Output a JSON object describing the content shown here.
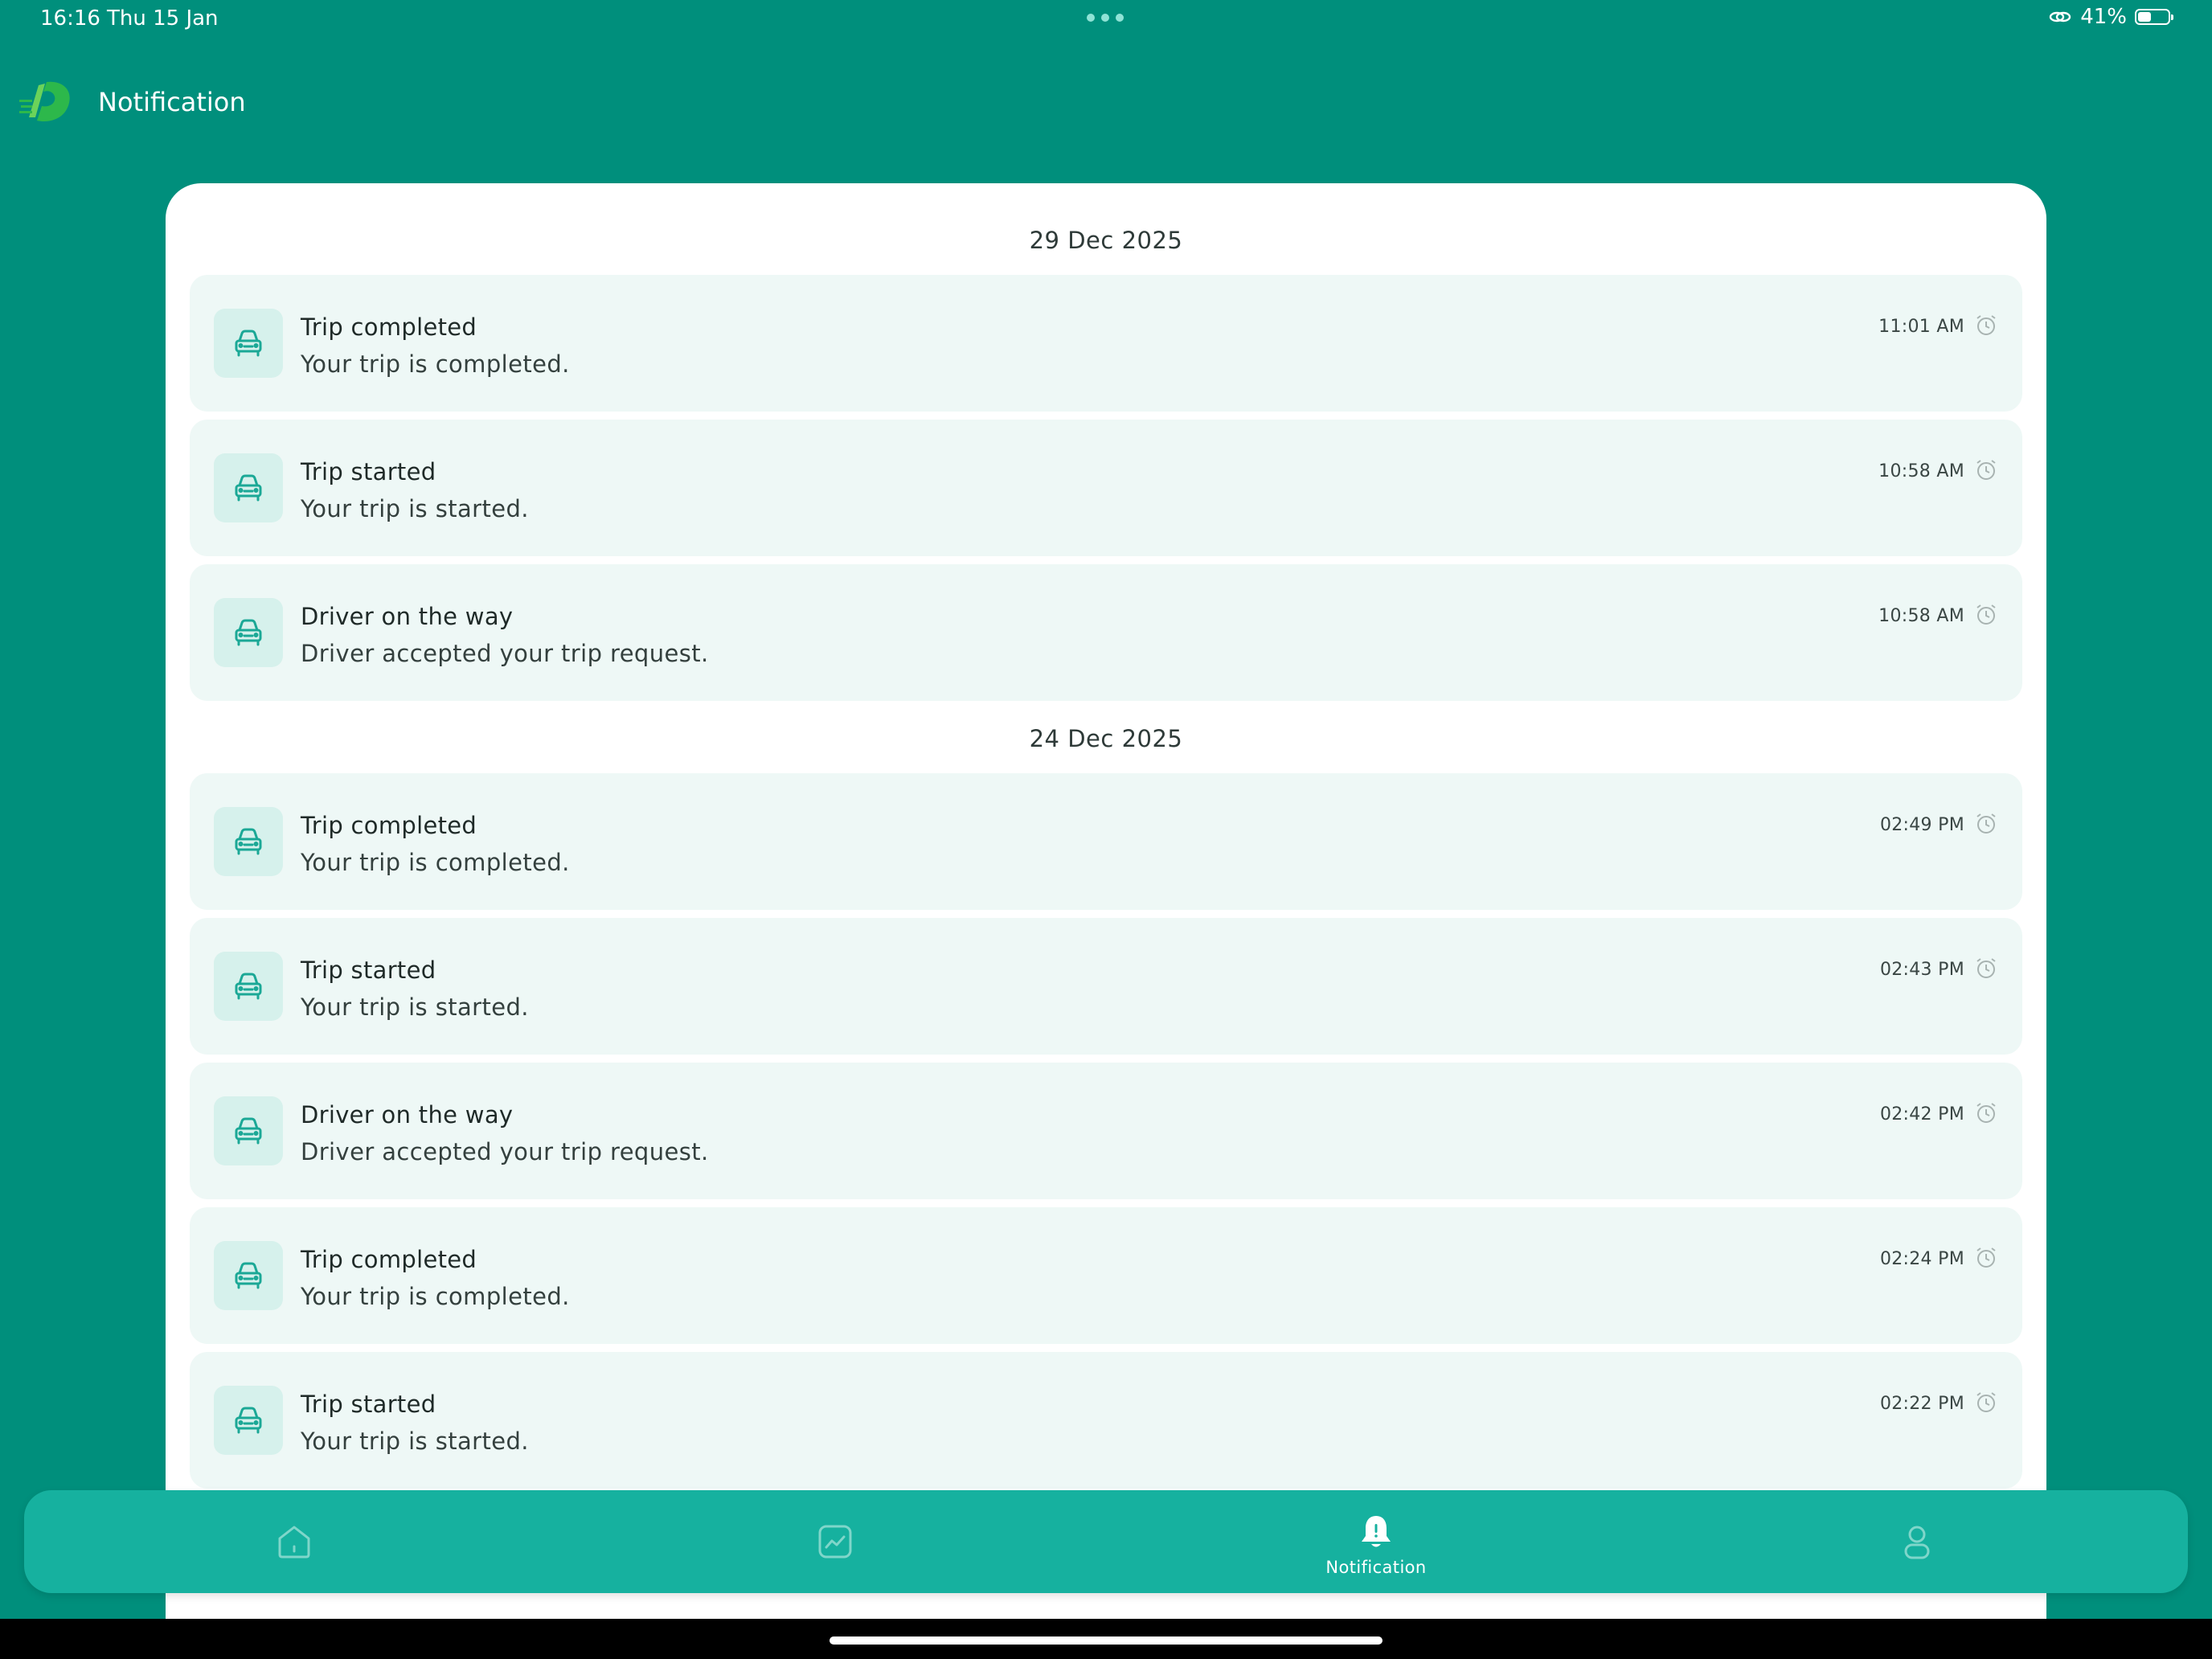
{
  "status_bar": {
    "time": "16:16",
    "date": "Thu 15 Jan",
    "battery": "41%",
    "battery_level": 0.41
  },
  "header": {
    "title": "Notification"
  },
  "colors": {
    "background": "#008F7C",
    "card": "#FFFFFF",
    "item_background": "#EEF8F6",
    "icon_background": "#D6F1EC",
    "accent": "#16B19F",
    "icon_color": "#1BA896"
  },
  "groups": [
    {
      "date": "29 Dec 2025",
      "items": [
        {
          "icon": "car-icon",
          "title": "Trip completed",
          "body": "Your trip is completed.",
          "time": "11:01 AM"
        },
        {
          "icon": "car-icon",
          "title": "Trip started",
          "body": "Your trip is started.",
          "time": "10:58 AM"
        },
        {
          "icon": "car-icon",
          "title": "Driver on the way",
          "body": "Driver accepted your trip request.",
          "time": "10:58 AM"
        }
      ]
    },
    {
      "date": "24 Dec 2025",
      "items": [
        {
          "icon": "car-icon",
          "title": "Trip completed",
          "body": "Your trip is completed.",
          "time": "02:49 PM"
        },
        {
          "icon": "car-icon",
          "title": "Trip started",
          "body": "Your trip is started.",
          "time": "02:43 PM"
        },
        {
          "icon": "car-icon",
          "title": "Driver on the way",
          "body": "Driver accepted your trip request.",
          "time": "02:42 PM"
        },
        {
          "icon": "car-icon",
          "title": "Trip completed",
          "body": "Your trip is completed.",
          "time": "02:24 PM"
        },
        {
          "icon": "car-icon",
          "title": "Trip started",
          "body": "Your trip is started.",
          "time": "02:22 PM"
        }
      ]
    }
  ],
  "bottom_nav": {
    "items": [
      {
        "icon": "home-icon",
        "label": ""
      },
      {
        "icon": "chart-icon",
        "label": ""
      },
      {
        "icon": "bell-icon",
        "label": "Notification",
        "active": true
      },
      {
        "icon": "user-icon",
        "label": ""
      }
    ]
  }
}
